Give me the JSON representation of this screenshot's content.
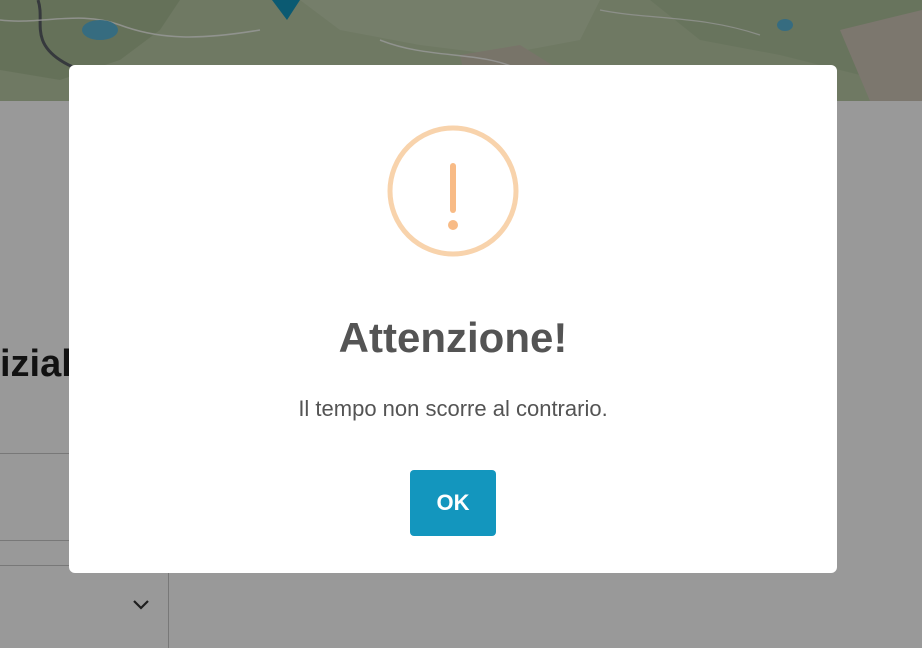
{
  "background": {
    "heading_fragment": "izial"
  },
  "modal": {
    "icon": "exclamation-warning-icon",
    "icon_color": "#f8bb86",
    "title": "Attenzione!",
    "message": "Il tempo non scorre al contrario.",
    "confirm_label": "OK",
    "confirm_color": "#1396be"
  }
}
